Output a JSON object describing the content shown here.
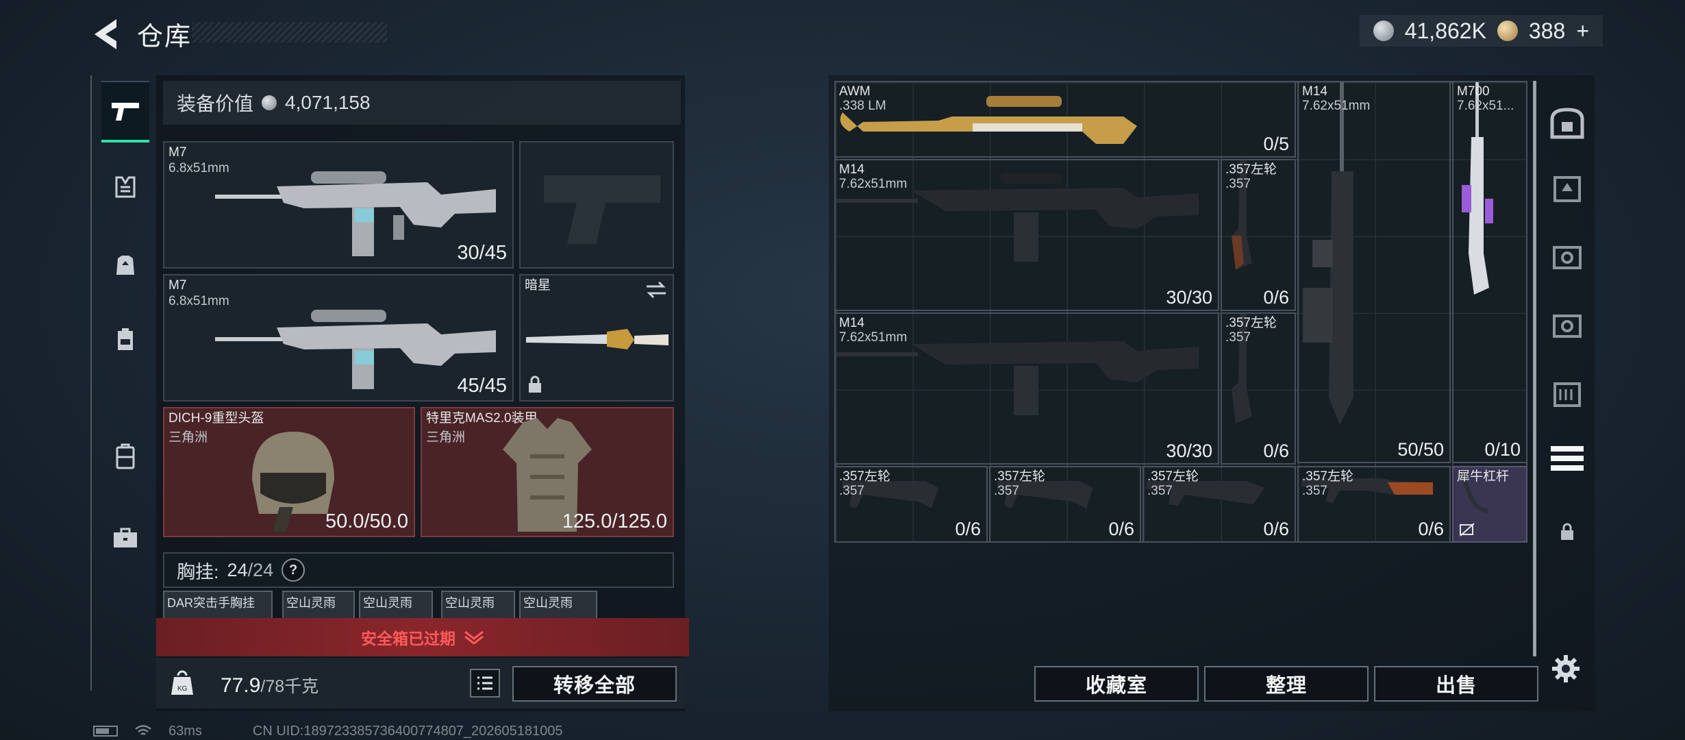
{
  "header": {
    "title": "仓库",
    "silver_amount": "41,862K",
    "gold_amount": "388",
    "gold_plus": "+"
  },
  "equipment": {
    "value_label": "装备价值",
    "value": "4,071,158",
    "primary_weapon": {
      "name": "M7",
      "caliber": "6.8x51mm",
      "ammo": "30/45"
    },
    "secondary_weapon": {
      "name": "M7",
      "caliber": "6.8x51mm",
      "ammo": "45/45"
    },
    "melee": {
      "name": "暗星"
    },
    "helmet": {
      "name": "DICH-9重型头盔",
      "faction": "三角洲",
      "durability": "50.0/50.0"
    },
    "armor": {
      "name": "特里克MAS2.0装甲",
      "faction": "三角洲",
      "durability": "125.0/125.0"
    },
    "chest_rig": {
      "label": "胸挂:",
      "used": "24",
      "capacity": "24",
      "help": "?"
    },
    "chest_items": [
      "DAR突击手胸挂",
      "空山灵雨",
      "空山灵雨",
      "空山灵雨",
      "空山灵雨"
    ],
    "safe_box_message": "安全箱已过期",
    "weight": "77.9",
    "weight_max": "/78千克",
    "transfer_all_label": "转移全部"
  },
  "warehouse": {
    "items": [
      {
        "name": "AWM",
        "caliber": ".338 LM",
        "count": "0/5"
      },
      {
        "name": "M14",
        "caliber": "7.62x51mm",
        "count": "50/50"
      },
      {
        "name": "M700",
        "caliber": "7.62x51...",
        "count": "0/10"
      },
      {
        "name": "M14",
        "caliber": "7.62x51mm",
        "count": "30/30"
      },
      {
        "name": ".357左轮",
        "caliber": ".357",
        "count": "0/6"
      },
      {
        "name": "M14",
        "caliber": "7.62x51mm",
        "count": "30/30"
      },
      {
        "name": ".357左轮",
        "caliber": ".357",
        "count": "0/6"
      },
      {
        "name": ".357左轮",
        "caliber": ".357",
        "count": "0/6"
      },
      {
        "name": ".357左轮",
        "caliber": ".357",
        "count": "0/6"
      },
      {
        "name": ".357左轮",
        "caliber": ".357",
        "count": "0/6"
      },
      {
        "name": ".357左轮",
        "caliber": ".357",
        "count": "0/6"
      },
      {
        "name": "犀牛杠杆",
        "caliber": "",
        "count": ""
      }
    ],
    "collection_label": "收藏室",
    "sort_label": "整理",
    "sell_label": "出售"
  },
  "status_bar": {
    "ping": "63ms",
    "uid": "CN UID:189723385736400774807_202605181005"
  }
}
